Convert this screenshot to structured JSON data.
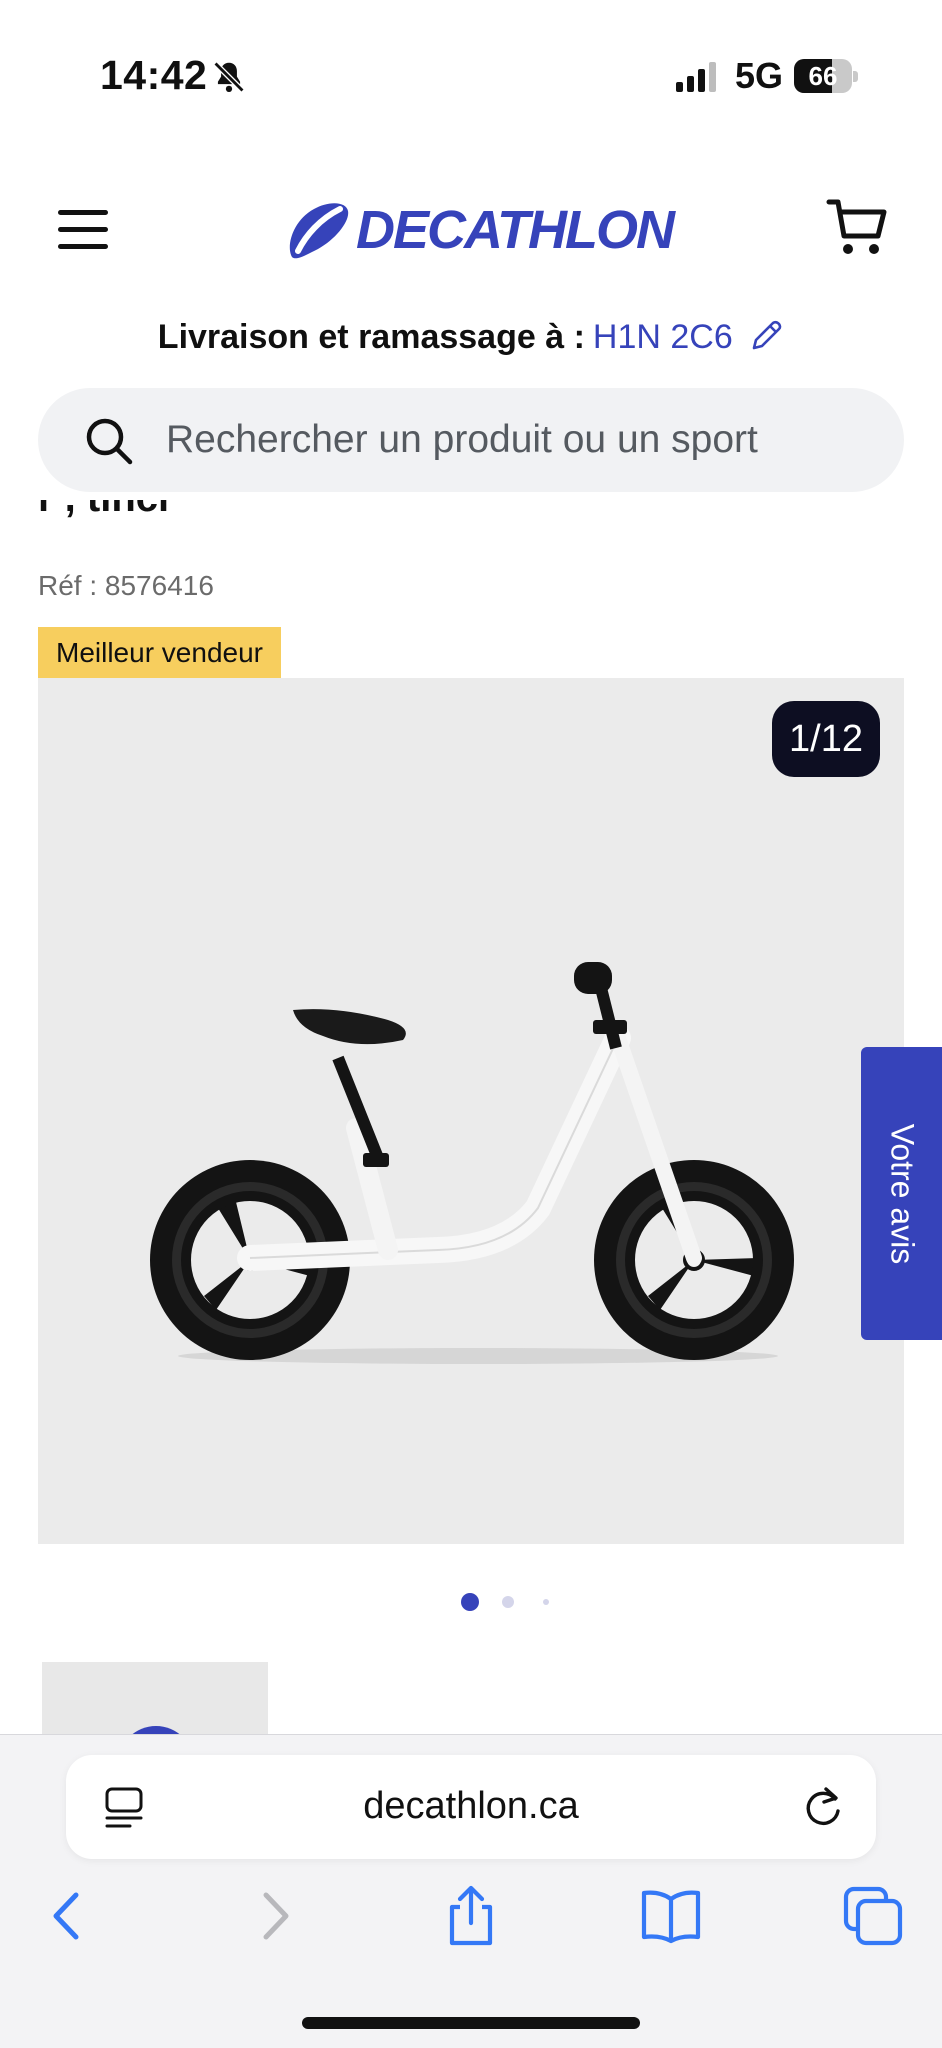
{
  "status_bar": {
    "time": "14:42",
    "network": "5G",
    "battery": "66",
    "battery_level": 0.66
  },
  "header": {
    "logo_text": "DECATHLON",
    "brand_color": "#3643BA",
    "delivery_label": "Livraison et ramassage à :",
    "postal_code": "H1N 2C6"
  },
  "search": {
    "placeholder": "Rechercher un produit ou un sport"
  },
  "product": {
    "title_fragment": "r , tinci",
    "reference": "Réf : 8576416",
    "badge": "Meilleur vendeur",
    "image_counter": "1/12"
  },
  "gallery": {
    "dots_count": 3,
    "active_dot": 0
  },
  "feedback_tab": {
    "label": "Votre avis"
  },
  "browser": {
    "url": "decathlon.ca"
  }
}
